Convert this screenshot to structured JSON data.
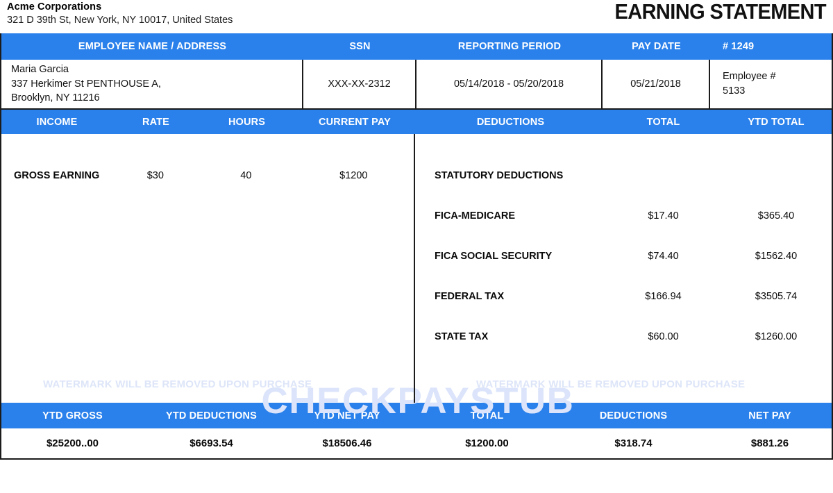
{
  "header": {
    "company_name": "Acme Corporations",
    "company_address": "321 D 39th St, New York, NY 10017, United States",
    "document_title": "EARNING STATEMENT"
  },
  "theme": {
    "band_blue": "#2b81eb",
    "watermark_blue": "#dbe4fa",
    "border_black": "#1b1b1b"
  },
  "employee_header": {
    "name_address": "EMPLOYEE NAME / ADDRESS",
    "ssn": "SSN",
    "reporting_period": "REPORTING PERIOD",
    "pay_date": "PAY DATE",
    "check_number": "# 1249"
  },
  "employee_info": {
    "name": "Maria Garcia",
    "address_line1": "337 Herkimer St PENTHOUSE A,",
    "address_line2": "Brooklyn, NY 11216",
    "ssn": "XXX-XX-2312",
    "reporting_period": "05/14/2018 - 05/20/2018",
    "pay_date": "05/21/2018",
    "employee_number_label": "Employee #",
    "employee_number": "5133"
  },
  "earnings_header": {
    "income": "INCOME",
    "rate": "RATE",
    "hours": "HOURS",
    "current_pay": "CURRENT PAY"
  },
  "deductions_header": {
    "deductions": "DEDUCTIONS",
    "total": "TOTAL",
    "ytd_total": "YTD TOTAL"
  },
  "earnings_rows": [
    {
      "income": "GROSS EARNING",
      "rate": "$30",
      "hours": "40",
      "current_pay": "$1200"
    }
  ],
  "deductions_section": {
    "section_title": "STATUTORY DEDUCTIONS",
    "rows": [
      {
        "label": "FICA-MEDICARE",
        "total": "$17.40",
        "ytd_total": "$365.40"
      },
      {
        "label": "FICA SOCIAL SECURITY",
        "total": "$74.40",
        "ytd_total": "$1562.40"
      },
      {
        "label": "FEDERAL TAX",
        "total": "$166.94",
        "ytd_total": "$3505.74"
      },
      {
        "label": "STATE TAX",
        "total": "$60.00",
        "ytd_total": "$1260.00"
      }
    ]
  },
  "watermarks": {
    "brand": "CHECKPAYSTUB",
    "notice_left": "WATERMARK WILL BE REMOVED UPON PURCHASE",
    "notice_right": "WATERMARK WILL BE REMOVED UPON PURCHASE"
  },
  "summary_header": {
    "ytd_gross": "YTD GROSS",
    "ytd_deductions": "YTD DEDUCTIONS",
    "ytd_net_pay": "YTD NET PAY",
    "total": "TOTAL",
    "deductions": "DEDUCTIONS",
    "net_pay": "NET PAY"
  },
  "summary_values": {
    "ytd_gross": "$25200..00",
    "ytd_deductions": "$6693.54",
    "ytd_net_pay": "$18506.46",
    "total": "$1200.00",
    "deductions": "$318.74",
    "net_pay": "$881.26"
  }
}
